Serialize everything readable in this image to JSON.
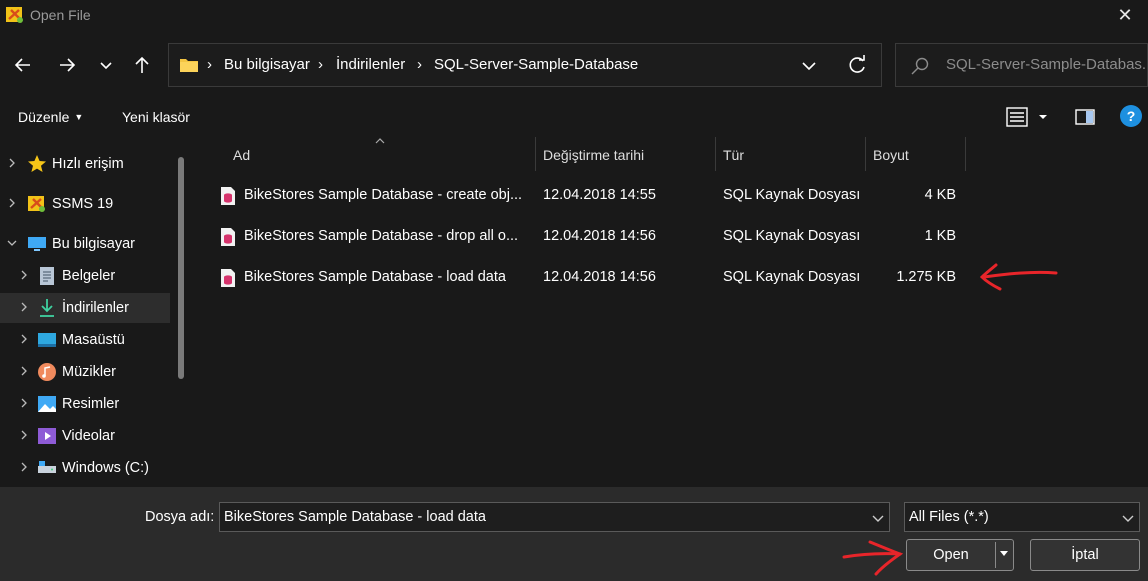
{
  "window": {
    "title": "Open File",
    "close_symbol": "✕"
  },
  "address": {
    "crumbs": [
      "Bu bilgisayar",
      "İndirilenler",
      "SQL-Server-Sample-Database"
    ],
    "separator": "›"
  },
  "search": {
    "placeholder": "SQL-Server-Sample-Databas..."
  },
  "toolbar": {
    "organize_label": "Düzenle",
    "new_folder_label": "Yeni klasör"
  },
  "sidebar": {
    "items": [
      {
        "label": "Hızlı erişim",
        "icon": "star-icon"
      },
      {
        "label": "SSMS 19",
        "icon": "ssms-icon"
      },
      {
        "label": "Bu bilgisayar",
        "icon": "computer-icon"
      },
      {
        "label": "Belgeler",
        "icon": "documents-icon"
      },
      {
        "label": "İndirilenler",
        "icon": "downloads-icon"
      },
      {
        "label": "Masaüstü",
        "icon": "desktop-icon"
      },
      {
        "label": "Müzikler",
        "icon": "music-icon"
      },
      {
        "label": "Resimler",
        "icon": "pictures-icon"
      },
      {
        "label": "Videolar",
        "icon": "videos-icon"
      },
      {
        "label": "Windows (C:)",
        "icon": "drive-icon"
      }
    ]
  },
  "columns": {
    "name": "Ad",
    "modified": "Değiştirme tarihi",
    "type": "Tür",
    "size": "Boyut"
  },
  "files": [
    {
      "name": "BikeStores Sample Database - create obj...",
      "modified": "12.04.2018 14:55",
      "type": "SQL Kaynak Dosyası",
      "size": "4 KB"
    },
    {
      "name": "BikeStores Sample Database - drop all o...",
      "modified": "12.04.2018 14:56",
      "type": "SQL Kaynak Dosyası",
      "size": "1 KB"
    },
    {
      "name": "BikeStores Sample Database - load data",
      "modified": "12.04.2018 14:56",
      "type": "SQL Kaynak Dosyası",
      "size": "1.275 KB"
    }
  ],
  "footer": {
    "filename_label": "Dosya adı:",
    "filename_value": "BikeStores Sample Database - load data",
    "filetype_value": "All Files (*.*)",
    "open_label": "Open",
    "cancel_label": "İptal"
  },
  "colors": {
    "annotation": "#e8252a",
    "accent": "#1e90e0"
  }
}
